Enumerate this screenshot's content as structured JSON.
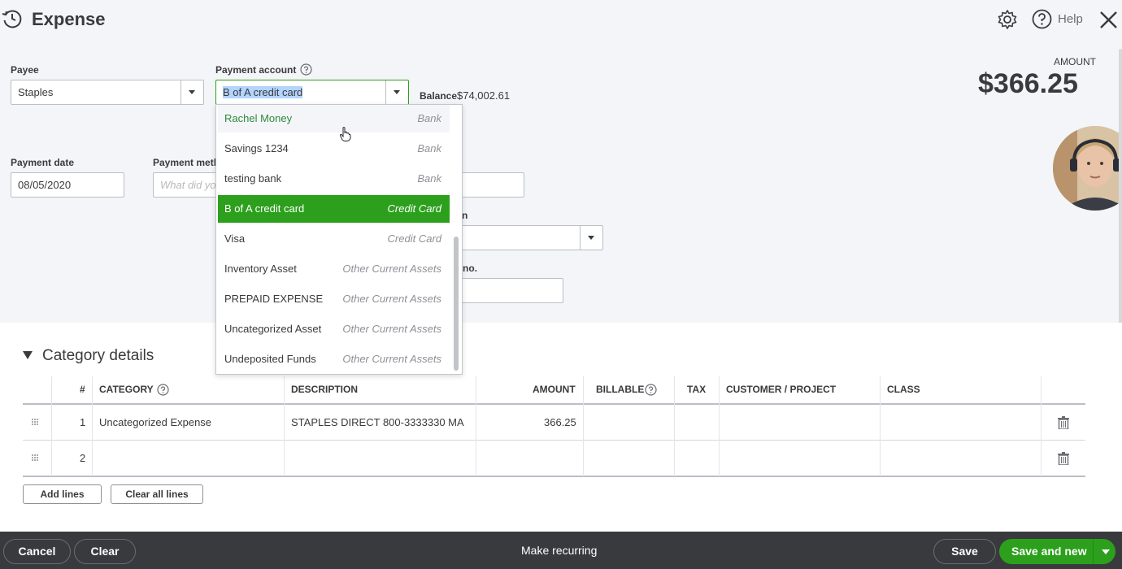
{
  "header": {
    "title": "Expense",
    "help_label": "Help"
  },
  "form": {
    "payee": {
      "label": "Payee",
      "value": "Staples"
    },
    "payment_account": {
      "label": "Payment account",
      "value": "B of A credit card"
    },
    "balance": {
      "label": "Balance",
      "value": "$74,002.61"
    },
    "payment_date": {
      "label": "Payment date",
      "value": "08/05/2020"
    },
    "payment_method": {
      "label_partial": "Payment meth",
      "placeholder_partial": "What did yo"
    },
    "hidden_field_1_label_tail": "n",
    "hidden_field_2_label_tail": "no."
  },
  "amount": {
    "label": "AMOUNT",
    "value": "$366.25"
  },
  "account_dropdown": {
    "items": [
      {
        "name": "Rachel Money",
        "type": "Bank",
        "state": "hover"
      },
      {
        "name": "Savings 1234",
        "type": "Bank",
        "state": "normal"
      },
      {
        "name": "testing bank",
        "type": "Bank",
        "state": "normal"
      },
      {
        "name": "B of A credit card",
        "type": "Credit Card",
        "state": "selected"
      },
      {
        "name": "Visa",
        "type": "Credit Card",
        "state": "normal"
      },
      {
        "name": "Inventory Asset",
        "type": "Other Current Assets",
        "state": "normal"
      },
      {
        "name": "PREPAID EXPENSE",
        "type": "Other Current Assets",
        "state": "normal"
      },
      {
        "name": "Uncategorized Asset",
        "type": "Other Current Assets",
        "state": "normal"
      },
      {
        "name": "Undeposited Funds",
        "type": "Other Current Assets",
        "state": "normal"
      }
    ]
  },
  "category_details": {
    "title": "Category details",
    "columns": {
      "num": "#",
      "category": "CATEGORY",
      "description": "DESCRIPTION",
      "amount": "AMOUNT",
      "billable": "BILLABLE",
      "tax": "TAX",
      "customer": "CUSTOMER / PROJECT",
      "class": "CLASS"
    },
    "rows": [
      {
        "num": "1",
        "category": "Uncategorized Expense",
        "description": "STAPLES DIRECT 800-3333330 MA",
        "amount": "366.25"
      },
      {
        "num": "2",
        "category": "",
        "description": "",
        "amount": ""
      }
    ],
    "add_lines": "Add lines",
    "clear_all_lines": "Clear all lines"
  },
  "footer": {
    "cancel": "Cancel",
    "clear": "Clear",
    "make_recurring": "Make recurring",
    "save": "Save",
    "save_and_new": "Save and new"
  },
  "colors": {
    "brand_green": "#2ca01c",
    "footer_bg": "#393a3d",
    "page_bg": "#f4f5f8"
  }
}
